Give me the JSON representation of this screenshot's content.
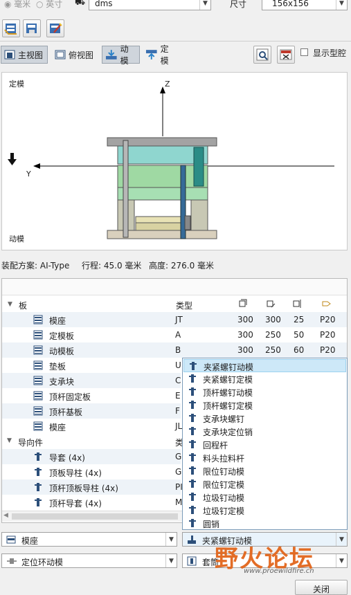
{
  "top": {
    "unit_mm": "毫米",
    "unit_inch": "英寸",
    "supplier_value": "dms",
    "size_label": "尺寸",
    "size_value": "156x156"
  },
  "view": {
    "main_view": "主视图",
    "top_view": "俯视图",
    "moving": "动模",
    "fixed": "定模",
    "show_cavity": "显示型腔"
  },
  "preview": {
    "fixed_label": "定模",
    "moving_label": "动模",
    "axis_z": "Z",
    "axis_y": "Y"
  },
  "info": {
    "assembly": "装配方案: AI-Type",
    "stroke": "行程: 45.0 毫米",
    "height": "高度: 276.0 毫米"
  },
  "table": {
    "group_plates": "板",
    "col_type": "类型",
    "group_guides": "导向件",
    "col_type2": "类",
    "rows": [
      {
        "name": "模座",
        "type": "JT",
        "v1": "300",
        "v2": "300",
        "v3": "25",
        "v4": "P20"
      },
      {
        "name": "定模板",
        "type": "A",
        "v1": "300",
        "v2": "250",
        "v3": "50",
        "v4": "P20"
      },
      {
        "name": "动模板",
        "type": "B",
        "v1": "300",
        "v2": "250",
        "v3": "60",
        "v4": "P20"
      },
      {
        "name": "垫板",
        "type": "U"
      },
      {
        "name": "支承块",
        "type": "C"
      },
      {
        "name": "顶杆固定板",
        "type": "E"
      },
      {
        "name": "顶杆基板",
        "type": "F"
      },
      {
        "name": "模座",
        "type": "JL"
      }
    ],
    "guide_rows": [
      {
        "name": "导套 (4x)",
        "type": "G"
      },
      {
        "name": "顶板导柱 (4x)",
        "type": "G"
      },
      {
        "name": "顶杆顶板导柱 (4x)",
        "type": "PI"
      },
      {
        "name": "顶杆导套 (4x)",
        "type": "M"
      }
    ]
  },
  "dropdown": {
    "items": [
      "夹紧螺钉动模",
      "夹紧螺钉定模",
      "顶杆螺钉动模",
      "顶杆螺钉定模",
      "支承块螺钉",
      "支承块定位销",
      "回程杆",
      "料头拉料杆",
      "限位钉动模",
      "限位钉定模",
      "垃圾钉动模",
      "垃圾钉定模",
      "圆销"
    ]
  },
  "bottom": {
    "left_select1": "模座",
    "right_select1": "夹紧螺钉动模",
    "left_select2": "定位环动模",
    "right_select2": "套筒",
    "close": "关闭"
  },
  "watermark": {
    "text1": "野火论坛",
    "text2": "www.proewildfire.cn"
  }
}
